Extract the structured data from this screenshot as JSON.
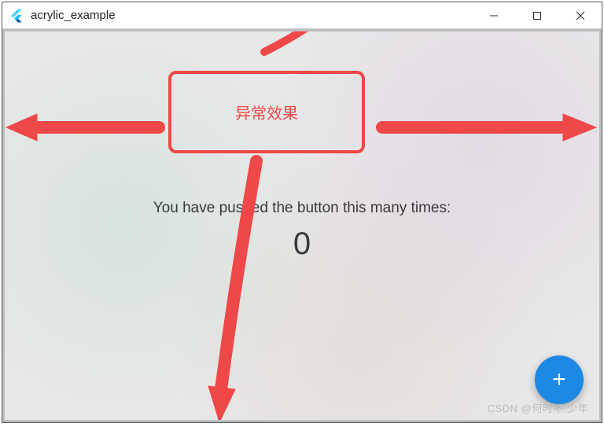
{
  "titlebar": {
    "title": "acrylic_example",
    "minimize_label": "minimize",
    "maximize_label": "maximize",
    "close_label": "close"
  },
  "annotation": {
    "label": "异常效果"
  },
  "main": {
    "push_text": "You have pushed the button this many times:",
    "count": "0"
  },
  "fab": {
    "icon_label": "+"
  },
  "watermark": "CSDN @何时不.少年",
  "colors": {
    "accent_red": "#ef4848",
    "fab_blue": "#1e88e5"
  }
}
